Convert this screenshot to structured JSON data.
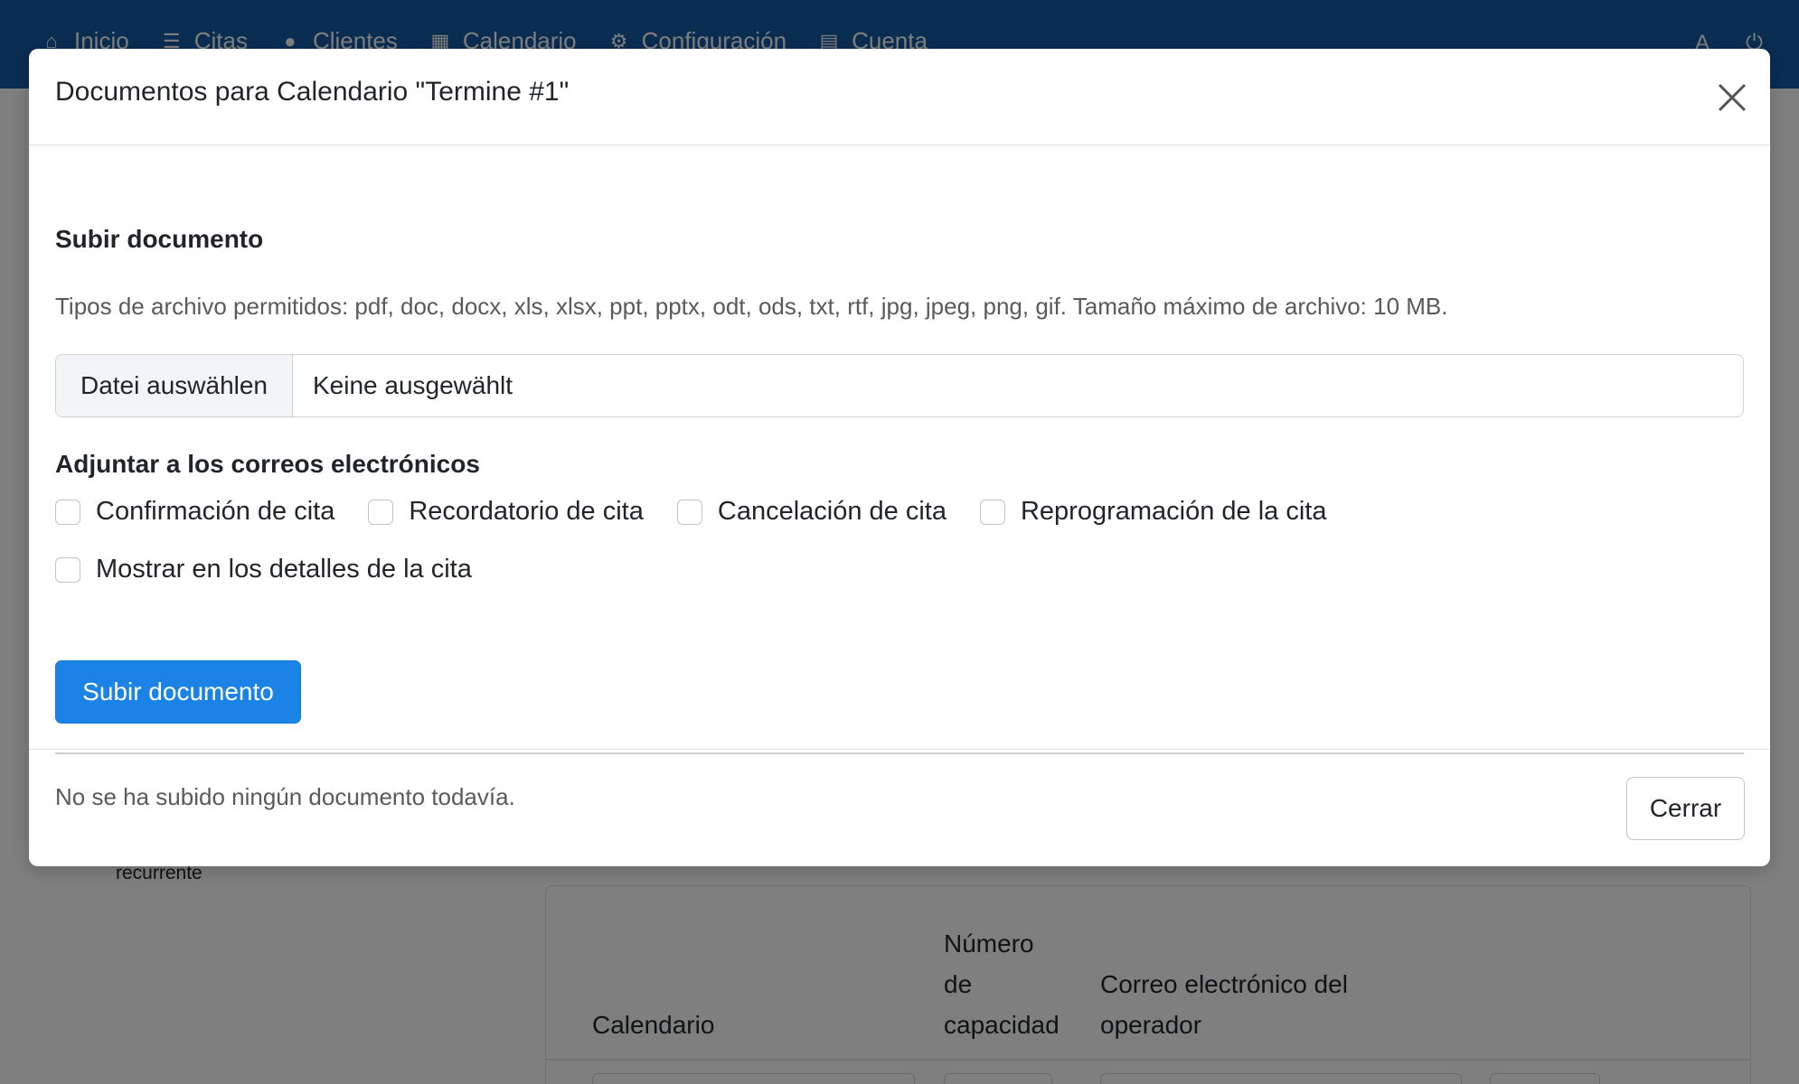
{
  "navbar": {
    "items": [
      {
        "label": "Inicio",
        "icon": "home-icon",
        "glyph": "⌂"
      },
      {
        "label": "Citas",
        "icon": "list-icon",
        "glyph": "☰"
      },
      {
        "label": "Clientes",
        "icon": "user-icon",
        "glyph": "●"
      },
      {
        "label": "Calendario",
        "icon": "calendar-icon",
        "glyph": "▦"
      },
      {
        "label": "Configuración",
        "icon": "gears-icon",
        "glyph": "⚙"
      },
      {
        "label": "Cuenta",
        "icon": "archive-icon",
        "glyph": "▤"
      }
    ],
    "language_glyph": "A̲",
    "power_glyph": "⏻",
    "color": "#155aa4"
  },
  "background": {
    "recurring_label": "recurrente",
    "table_headers": {
      "calendar": "Calendario",
      "capacity": [
        "Número",
        "de",
        "capacidad"
      ],
      "operator_email": [
        "Correo electrónico del",
        "operador"
      ]
    }
  },
  "modal": {
    "title": "Documentos para Calendario \"Termine #1\"",
    "upload_section_title": "Subir documento",
    "allowed_types_text": "Tipos de archivo permitidos: pdf, doc, docx, xls, xlsx, ppt, pptx, odt, ods, txt, rtf, jpg, jpeg, png, gif. Tamaño máximo de archivo: 10 MB.",
    "file_input": {
      "button_label": "Datei auswählen",
      "status": "Keine ausgewählt"
    },
    "attach_title": "Adjuntar a los correos electrónicos",
    "checkboxes_row1": [
      {
        "label": "Confirmación de cita",
        "checked": false
      },
      {
        "label": "Recordatorio de cita",
        "checked": false
      },
      {
        "label": "Cancelación de cita",
        "checked": false
      },
      {
        "label": "Reprogramación de la cita",
        "checked": false
      }
    ],
    "checkbox_details": {
      "label": "Mostrar en los detalles de la cita",
      "checked": false
    },
    "upload_button_label": "Subir documento",
    "empty_text": "No se ha subido ningún documento todavía.",
    "close_button_label": "Cerrar",
    "accent_color": "#1a83e5"
  }
}
